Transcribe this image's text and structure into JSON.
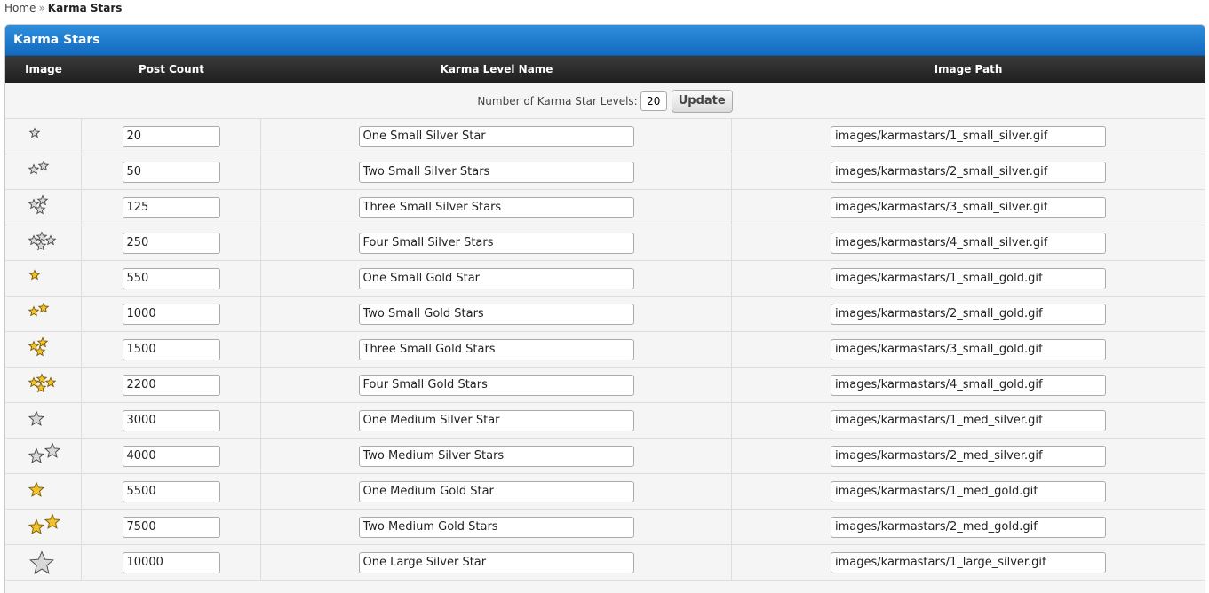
{
  "breadcrumb": {
    "home": "Home",
    "separator": "»",
    "current": "Karma Stars"
  },
  "panel": {
    "title": "Karma Stars"
  },
  "columns": {
    "image": "Image",
    "post_count": "Post Count",
    "level_name": "Karma Level Name",
    "image_path": "Image Path"
  },
  "levels": {
    "label": "Number of Karma Star Levels:",
    "value": "20",
    "update_label": "Update"
  },
  "colors": {
    "silver_star": "#d8d8d8",
    "gold_star": "#f2c12e",
    "header_blue": "#1a78cf"
  },
  "rows": [
    {
      "icon": "one-small-silver-star-icon",
      "post_count": "20",
      "name": "One Small Silver Star",
      "path": "images/karmastars/1_small_silver.gif"
    },
    {
      "icon": "two-small-silver-stars-icon",
      "post_count": "50",
      "name": "Two Small Silver Stars",
      "path": "images/karmastars/2_small_silver.gif"
    },
    {
      "icon": "three-small-silver-stars-icon",
      "post_count": "125",
      "name": "Three Small Silver Stars",
      "path": "images/karmastars/3_small_silver.gif"
    },
    {
      "icon": "four-small-silver-stars-icon",
      "post_count": "250",
      "name": "Four Small Silver Stars",
      "path": "images/karmastars/4_small_silver.gif"
    },
    {
      "icon": "one-small-gold-star-icon",
      "post_count": "550",
      "name": "One Small Gold Star",
      "path": "images/karmastars/1_small_gold.gif"
    },
    {
      "icon": "two-small-gold-stars-icon",
      "post_count": "1000",
      "name": "Two Small Gold Stars",
      "path": "images/karmastars/2_small_gold.gif"
    },
    {
      "icon": "three-small-gold-stars-icon",
      "post_count": "1500",
      "name": "Three Small Gold Stars",
      "path": "images/karmastars/3_small_gold.gif"
    },
    {
      "icon": "four-small-gold-stars-icon",
      "post_count": "2200",
      "name": "Four Small Gold Stars",
      "path": "images/karmastars/4_small_gold.gif"
    },
    {
      "icon": "one-medium-silver-star-icon",
      "post_count": "3000",
      "name": "One Medium Silver Star",
      "path": "images/karmastars/1_med_silver.gif"
    },
    {
      "icon": "two-medium-silver-stars-icon",
      "post_count": "4000",
      "name": "Two Medium Silver Stars",
      "path": "images/karmastars/2_med_silver.gif"
    },
    {
      "icon": "one-medium-gold-star-icon",
      "post_count": "5500",
      "name": "One Medium Gold Star",
      "path": "images/karmastars/1_med_gold.gif"
    },
    {
      "icon": "two-medium-gold-stars-icon",
      "post_count": "7500",
      "name": "Two Medium Gold Stars",
      "path": "images/karmastars/2_med_gold.gif"
    },
    {
      "icon": "one-large-silver-star-icon",
      "post_count": "10000",
      "name": "One Large Silver Star",
      "path": "images/karmastars/1_large_silver.gif"
    }
  ]
}
